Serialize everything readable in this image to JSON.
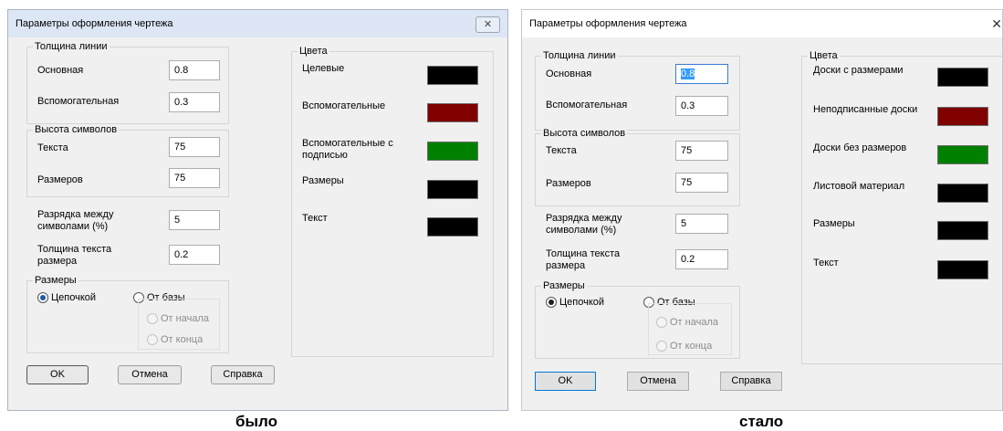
{
  "old": {
    "title": "Параметры оформления чертежа",
    "close_glyph": "✕",
    "line_thickness": {
      "legend": "Толщина линии",
      "main_label": "Основная",
      "main_value": "0.8",
      "aux_label": "Вспомогательная",
      "aux_value": "0.3"
    },
    "symbol_height": {
      "legend": "Высота символов",
      "text_label": "Текста",
      "text_value": "75",
      "dims_label": "Размеров",
      "dims_value": "75"
    },
    "spacing_label": "Разрядка между символами (%)",
    "spacing_value": "5",
    "dim_text_thickness_label": "Толщина текста размера",
    "dim_text_thickness_value": "0.2",
    "dims": {
      "legend": "Размеры",
      "chain_label": "Цепочкой",
      "base_label": "От базы",
      "from_start_label": "От начала",
      "from_end_label": "От конца"
    },
    "colors": {
      "legend": "Цвета",
      "items": [
        {
          "label": "Целевые",
          "color": "#000000"
        },
        {
          "label": "Вспомогательные",
          "color": "#800000"
        },
        {
          "label": "Вспомогательные с подписью",
          "color": "#008000"
        },
        {
          "label": "Размеры",
          "color": "#000000"
        },
        {
          "label": "Текст",
          "color": "#000000"
        }
      ]
    },
    "buttons": {
      "ok": "OK",
      "cancel": "Отмена",
      "help": "Справка"
    },
    "caption": "было"
  },
  "new": {
    "title": "Параметры оформления чертежа",
    "close_glyph": "✕",
    "line_thickness": {
      "legend": "Толщина линии",
      "main_label": "Основная",
      "main_value": "0.8",
      "aux_label": "Вспомогательная",
      "aux_value": "0.3"
    },
    "symbol_height": {
      "legend": "Высота символов",
      "text_label": "Текста",
      "text_value": "75",
      "dims_label": "Размеров",
      "dims_value": "75"
    },
    "spacing_label": "Разрядка между символами (%)",
    "spacing_value": "5",
    "dim_text_thickness_label": "Толщина текста размера",
    "dim_text_thickness_value": "0.2",
    "dims": {
      "legend": "Размеры",
      "chain_label": "Цепочкой",
      "base_label": "От базы",
      "from_start_label": "От начала",
      "from_end_label": "От конца"
    },
    "colors": {
      "legend": "Цвета",
      "items": [
        {
          "label": "Доски с размерами",
          "color": "#000000"
        },
        {
          "label": "Неподписанные доски",
          "color": "#800000"
        },
        {
          "label": "Доски без размеров",
          "color": "#008000"
        },
        {
          "label": "Листовой материал",
          "color": "#000000"
        },
        {
          "label": "Размеры",
          "color": "#000000"
        },
        {
          "label": "Текст",
          "color": "#000000"
        }
      ]
    },
    "buttons": {
      "ok": "OK",
      "cancel": "Отмена",
      "help": "Справка"
    },
    "caption": "стало"
  }
}
